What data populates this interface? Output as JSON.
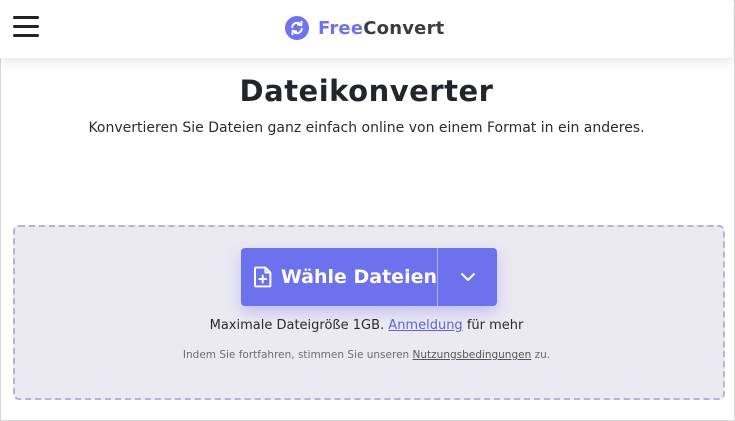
{
  "header": {
    "brand_free": "Free",
    "brand_convert": "Convert",
    "menu_icon": "hamburger-menu-icon",
    "logo_icon": "sync-arrows-icon"
  },
  "main": {
    "title": "Dateikonverter",
    "subtitle": "Konvertieren Sie Dateien ganz einfach online von einem Format in ein anderes."
  },
  "upload": {
    "button_label": "Wähle Dateien",
    "button_icon": "file-plus-icon",
    "dropdown_icon": "chevron-down-icon",
    "limit_prefix": "Maximale Dateigröße 1GB.",
    "limit_link": "Anmeldung",
    "limit_suffix": "für mehr",
    "terms_prefix": "Indem Sie fortfahren, stimmen Sie unseren",
    "terms_link": "Nutzungsbedingungen",
    "terms_suffix": "zu."
  },
  "colors": {
    "accent": "#6c71ee",
    "dropzone_bg": "#ebeaf2",
    "dropzone_border": "#b9b3cf",
    "text_dark": "#23252e"
  }
}
